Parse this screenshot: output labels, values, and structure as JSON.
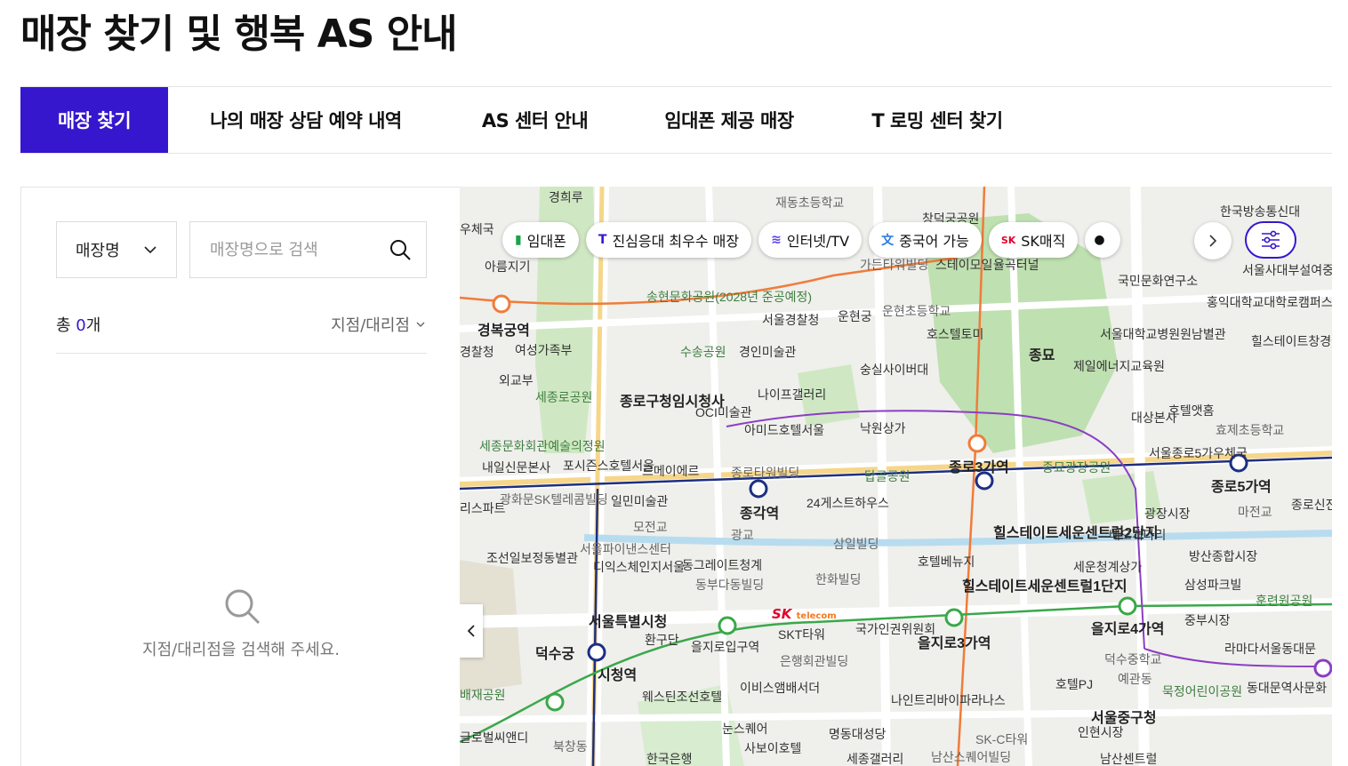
{
  "page": {
    "title": "매장 찾기 및 행복 AS 안내"
  },
  "tabs": [
    {
      "label": "매장 찾기",
      "active": true
    },
    {
      "label": "나의 매장 상담 예약 내역"
    },
    {
      "label": "AS 센터 안내"
    },
    {
      "label": "임대폰 제공 매장"
    },
    {
      "label": "T 로밍 센터 찾기"
    }
  ],
  "search": {
    "type_selected": "매장명",
    "placeholder": "매장명으로 검색",
    "value": ""
  },
  "results": {
    "count_prefix": "총 ",
    "count": "0",
    "count_suffix": "개",
    "sort_label": "지점/대리점",
    "empty_message": "지점/대리점을 검색해 주세요."
  },
  "map": {
    "chips": [
      {
        "label": "임대폰",
        "icon": "phone-icon"
      },
      {
        "label": "진심응대 최우수 매장",
        "icon": "t-icon"
      },
      {
        "label": "인터넷/TV",
        "icon": "router-icon"
      },
      {
        "label": "중국어 가능",
        "icon": "chinese-icon"
      },
      {
        "label": "SK매직",
        "icon": "sk-icon"
      }
    ],
    "labels": [
      "경희루",
      "재동초등학교",
      "우체국",
      "창덕궁공원",
      "한국방송통신대",
      "아름지기",
      "가든타워빌딩",
      "스테이모일",
      "율곡터널",
      "국민문화연구소",
      "서울사대부설여중",
      "홍익대학교대학로캠퍼스",
      "송현문화공원(2028년 준공예정)",
      "서울경찰청",
      "운현궁",
      "운현초등학교",
      "경복궁역",
      "여성가족부",
      "호스텔토미",
      "종묘",
      "서울대학교병원원남별관",
      "힐스테이트창경궁아파트",
      "경찰청",
      "수송공원",
      "경인미술관",
      "숭실사이버대",
      "제일에너지교육원",
      "외교부",
      "세종로공원",
      "종로구청임시청사",
      "나이프갤러리",
      "OCI미술관",
      "아미드호텔서울",
      "낙원상가",
      "대상본사",
      "호텔앳홈",
      "효제초등학교",
      "세종문화회관예술의정원",
      "포시즌스호텔서울",
      "르메이에르",
      "종로타워빌딩",
      "탑골공원",
      "종로3가역",
      "종묘광장공원",
      "서울종로5가우체국",
      "종로5가역",
      "내일신문본사",
      "광화문SK텔레콤빌딩",
      "일민미술관",
      "종각역",
      "24게스트하우스",
      "광장시장",
      "마전교",
      "종로신진통일상가",
      "모전교",
      "광교",
      "힐스테이트세운센트럴2단지",
      "배오개다리",
      "방산종합시장",
      "서울파이낸스센터",
      "삼일빌딩",
      "호텔베뉴지",
      "세운청계상가",
      "조선일보정동별관",
      "디익스체인지서울",
      "동그레이트청계",
      "동부다동빌딩",
      "힐스테이트세운센트럴1단지",
      "삼성파크빌",
      "훈련원공원",
      "한화빌딩",
      "서울특별시청",
      "을지로4가역",
      "중부시장",
      "국가인권위원회",
      "을지로3가역",
      "환구단",
      "을지로입구역",
      "SKT타워",
      "라마다서울동대문",
      "덕수궁",
      "덕수중학교",
      "시청역",
      "은행회관빌딩",
      "배재공원",
      "웨스틴조선호텔",
      "이비스앰배서더",
      "나인트리바이파라나스",
      "호텔PJ",
      "예관동",
      "동대문역사문화",
      "묵정어린이공원",
      "서울중구청",
      "인현시장",
      "눈스퀘어",
      "명동대성당",
      "SK-C타워",
      "글로벌씨앤디",
      "사보이호텔",
      "북창동",
      "한국은행",
      "세종갤러리",
      "남산스퀘어빌딩",
      "남산센트럴",
      "리스파트"
    ]
  }
}
